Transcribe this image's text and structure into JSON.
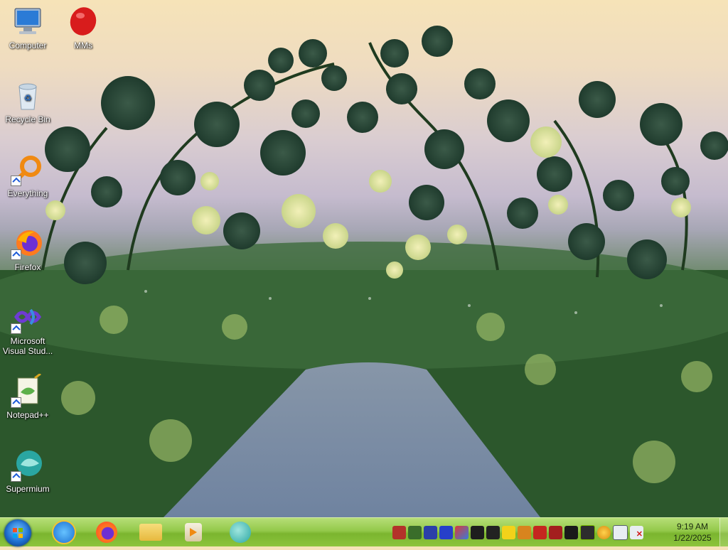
{
  "desktop": {
    "icons": [
      {
        "label": "Computer",
        "icon": "computer-icon"
      },
      {
        "label": "MMs",
        "icon": "mms-candy-icon"
      },
      {
        "label": "Recycle Bin",
        "icon": "recycle-bin-icon"
      },
      {
        "label": "Everything",
        "icon": "everything-search-icon"
      },
      {
        "label": "Firefox",
        "icon": "firefox-icon"
      },
      {
        "label": "Microsoft Visual Stud...",
        "icon": "visual-studio-icon"
      },
      {
        "label": "Notepad++",
        "icon": "notepadpp-icon"
      },
      {
        "label": "Supermium",
        "icon": "supermium-icon"
      }
    ]
  },
  "taskbar": {
    "pinned": [
      "start-orb-icon",
      "internet-explorer-icon",
      "firefox-icon",
      "file-explorer-icon",
      "media-player-icon",
      "supermium-icon"
    ],
    "tray": [
      "tray-app-1",
      "tray-app-2",
      "tray-app-3",
      "tray-app-4",
      "tray-app-5",
      "tray-app-6",
      "tray-app-7",
      "tray-app-8",
      "tray-app-9",
      "tray-app-10",
      "tray-app-11",
      "tray-app-12",
      "nvidia-icon",
      "magnifier-icon",
      "network-icon",
      "volume-muted-icon"
    ],
    "clock": {
      "time": "9:19 AM",
      "date": "1/22/2025"
    }
  },
  "colors": {
    "taskbar": "#8cc43c",
    "text_on_desktop": "#ffffff",
    "sky": "#f6e3b8",
    "foliage": "#2b4f2a"
  }
}
